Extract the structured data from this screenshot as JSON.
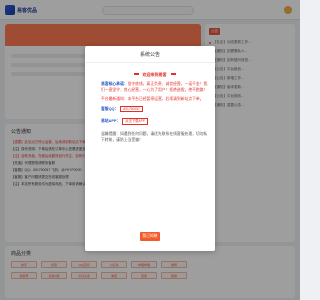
{
  "colors": {
    "accent": "#f25a2c",
    "link_blue": "#2a59c8",
    "alert_red": "#e0322a"
  },
  "header": {
    "logo_text": "易客优品"
  },
  "news": {
    "tag": "公告",
    "items": [
      "【社区】动态更新工作...",
      "【通知】如需要私人...",
      "【通知】如有疑问请咨...",
      "【公告】平台新品...",
      "【公告】新增工作...",
      "【通知】版本更新...",
      "【公告】平台规则...",
      "【通知】重要公告..."
    ]
  },
  "notice": {
    "title": "公告通知",
    "lines": [
      {
        "text": "【重要】此站点已停止运营，后续请到新站点下单，或平台联系客服...千万不要相信他人的转账请求！",
        "red": true
      },
      {
        "text": "【注】操作说明：下单后请在订单中心查看进度及结果，未到账请及时联系客服处理",
        "red": false
      },
      {
        "text": "【注】自助充值，充值后余额请自行关注，如有问题请联系平台在线客服",
        "red": true
      },
      {
        "text": "【充值】代理提现请联系客服",
        "red": false
      },
      {
        "text": "【客服】QQ：651750057 飞机：@YKYP0000",
        "red": false
      },
      {
        "text": "【客服】客户问题请提交在线客服处理",
        "red": false
      },
      {
        "text": "【注】本站所有服务均为虚拟商品，下单前请确认",
        "red": false
      }
    ]
  },
  "products": {
    "title": "商品分类",
    "chips": [
      "快手",
      "抖音",
      "QQ空间",
      "小红书",
      "哔哩哔哩",
      "微博",
      "视频号",
      "全民K歌",
      "今日头条",
      "淘宝",
      "百度",
      "其他"
    ]
  },
  "modal": {
    "title": "系统公告",
    "welcome": "欢迎来到易客",
    "p1_label": "易客核心承诺：",
    "p1_text": "坚守底线，真正负责、诚信经营，一诺千金！我们一直坚守、良心经营，一心为了用户！拒绝造假，绝不跑路！",
    "p2_red": "平台最新通知：本平台已经暂停运营，后续请到新站点下单。",
    "p2_gray": "",
    "qq_label": "客服QQ：",
    "qq_value": "651750057",
    "app_label": "易站APP：",
    "app_value": "点击下载APP",
    "p3": "温馨提醒：如遇到任何问题，请优先联系在线客服处理，切勿私下转账，谨防上当受骗！",
    "ok": "我已知晓"
  }
}
